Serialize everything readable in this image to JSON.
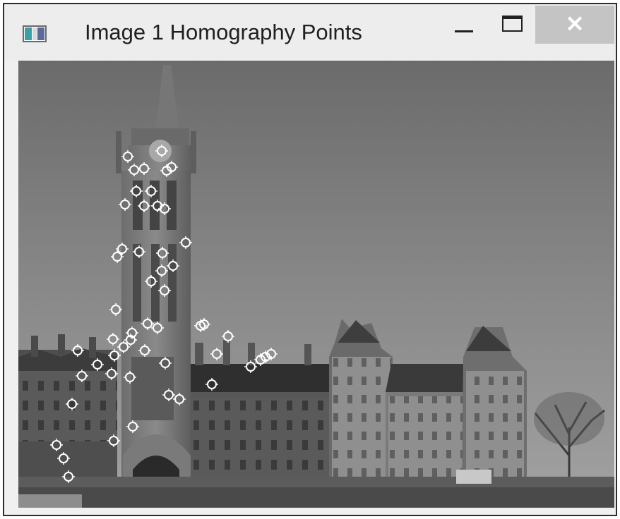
{
  "window": {
    "title": "Image 1 Homography Points",
    "icon": "app-window-icon",
    "controls": {
      "minimize_icon": "minimize-icon",
      "maximize_icon": "maximize-icon",
      "close_icon": "close-icon",
      "close_glyph": "✕"
    }
  },
  "image": {
    "description_icon": "grayscale-photo",
    "marker_style": "white-circle-crosshair",
    "marker_color": "#ffffff",
    "keypoint_count": 62
  },
  "colors": {
    "titlebar": "#ededed",
    "close_button": "#c4c4c4",
    "border": "#2d2d2d"
  }
}
